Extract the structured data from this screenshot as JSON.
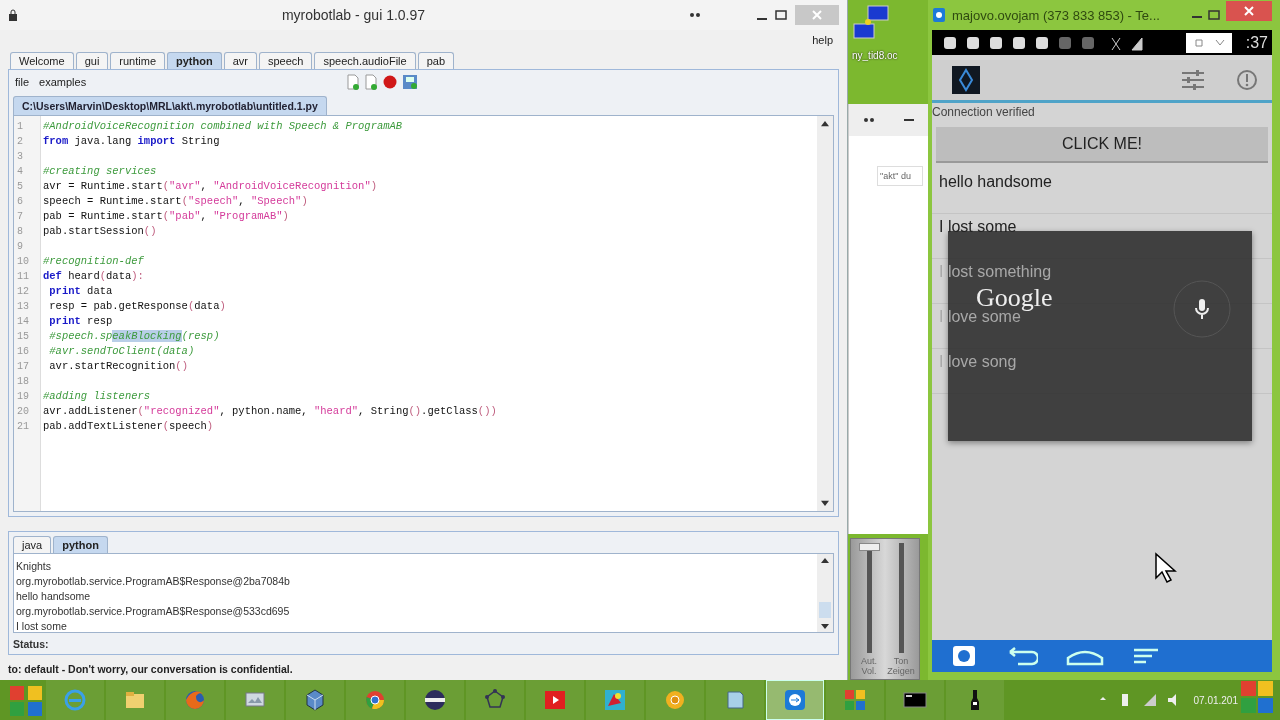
{
  "editor_window": {
    "title": "myrobotlab - gui 1.0.97",
    "menu": [
      "help"
    ],
    "tabs": [
      {
        "label": "Welcome",
        "selected": false
      },
      {
        "label": "gui",
        "selected": false
      },
      {
        "label": "runtime",
        "selected": false
      },
      {
        "label": "python",
        "selected": true
      },
      {
        "label": "avr",
        "selected": false
      },
      {
        "label": "speech",
        "selected": false
      },
      {
        "label": "speech.audioFile",
        "selected": false
      },
      {
        "label": "pab",
        "selected": false
      }
    ],
    "toolbar_menu": [
      "file",
      "examples"
    ],
    "file_tab": "C:\\Users\\Marvin\\Desktop\\MRL\\akt\\.myrobotlab\\untitled.1.py",
    "code": [
      {
        "number": "1",
        "segments": [
          {
            "text": "#AndroidVoiceRecognition combined with Speech & ProgramAB",
            "kind": "comment"
          }
        ]
      },
      {
        "number": "2",
        "segments": [
          {
            "text": "from",
            "kind": "keyword"
          },
          {
            "text": " java.lang ",
            "kind": "plain"
          },
          {
            "text": "import",
            "kind": "keyword"
          },
          {
            "text": " String",
            "kind": "plain"
          }
        ]
      },
      {
        "number": "3"
      },
      {
        "number": "4",
        "segments": [
          {
            "text": "#creating services",
            "kind": "comment"
          }
        ]
      },
      {
        "number": "5",
        "segments": [
          {
            "text": "avr = Runtime.start",
            "kind": "plain"
          },
          {
            "text": "(",
            "kind": "punct"
          },
          {
            "text": "\"avr\"",
            "kind": "string"
          },
          {
            "text": ", ",
            "kind": "plain"
          },
          {
            "text": "\"AndroidVoiceRecognition\"",
            "kind": "string"
          },
          {
            "text": ")",
            "kind": "punct"
          }
        ]
      },
      {
        "number": "6",
        "segments": [
          {
            "text": "speech = Runtime.start",
            "kind": "plain"
          },
          {
            "text": "(",
            "kind": "punct"
          },
          {
            "text": "\"speech\"",
            "kind": "string"
          },
          {
            "text": ", ",
            "kind": "plain"
          },
          {
            "text": "\"Speech\"",
            "kind": "string"
          },
          {
            "text": ")",
            "kind": "punct"
          }
        ]
      },
      {
        "number": "7",
        "segments": [
          {
            "text": "pab = Runtime.start",
            "kind": "plain"
          },
          {
            "text": "(",
            "kind": "punct"
          },
          {
            "text": "\"pab\"",
            "kind": "string"
          },
          {
            "text": ", ",
            "kind": "plain"
          },
          {
            "text": "\"ProgramAB\"",
            "kind": "string"
          },
          {
            "text": ")",
            "kind": "punct"
          }
        ]
      },
      {
        "number": "8",
        "segments": [
          {
            "text": "pab.startSession",
            "kind": "plain"
          },
          {
            "text": "()",
            "kind": "punct"
          }
        ]
      },
      {
        "number": "9"
      },
      {
        "number": "10",
        "segments": [
          {
            "text": "#recognition-def",
            "kind": "comment"
          }
        ]
      },
      {
        "number": "11",
        "segments": [
          {
            "text": "def",
            "kind": "keyword"
          },
          {
            "text": " heard",
            "kind": "plain"
          },
          {
            "text": "(",
            "kind": "punct"
          },
          {
            "text": "data",
            "kind": "plain"
          },
          {
            "text": "):",
            "kind": "punct"
          }
        ]
      },
      {
        "number": "12",
        "segments": [
          {
            "text": " print",
            "kind": "keyword"
          },
          {
            "text": " data",
            "kind": "plain"
          }
        ]
      },
      {
        "number": "13",
        "segments": [
          {
            "text": " resp = pab.getResponse",
            "kind": "plain"
          },
          {
            "text": "(",
            "kind": "punct"
          },
          {
            "text": "data",
            "kind": "plain"
          },
          {
            "text": ")",
            "kind": "punct"
          }
        ]
      },
      {
        "number": "14",
        "segments": [
          {
            "text": " print",
            "kind": "keyword"
          },
          {
            "text": " resp",
            "kind": "plain"
          }
        ]
      },
      {
        "number": "15",
        "segments": [
          {
            "text": " #speech.sp",
            "kind": "comment"
          },
          {
            "text": "eakBlocking",
            "kind": "selection"
          },
          {
            "text": "(resp)",
            "kind": "comment"
          }
        ]
      },
      {
        "number": "16",
        "segments": [
          {
            "text": " #avr.sendToClient(data)",
            "kind": "comment"
          }
        ]
      },
      {
        "number": "17",
        "segments": [
          {
            "text": " avr.startRecognition",
            "kind": "plain"
          },
          {
            "text": "()",
            "kind": "punct"
          }
        ]
      },
      {
        "number": "18"
      },
      {
        "number": "19",
        "segments": [
          {
            "text": "#adding listeners",
            "kind": "comment"
          }
        ]
      },
      {
        "number": "20",
        "segments": [
          {
            "text": "avr.addListener",
            "kind": "plain"
          },
          {
            "text": "(",
            "kind": "punct"
          },
          {
            "text": "\"recognized\"",
            "kind": "string"
          },
          {
            "text": ", python.name, ",
            "kind": "plain"
          },
          {
            "text": "\"heard\"",
            "kind": "string"
          },
          {
            "text": ", String",
            "kind": "plain"
          },
          {
            "text": "()",
            "kind": "punct"
          },
          {
            "text": ".getClass",
            "kind": "plain"
          },
          {
            "text": "())",
            "kind": "punct"
          }
        ]
      },
      {
        "number": "21",
        "segments": [
          {
            "text": "pab.addTextListener",
            "kind": "plain"
          },
          {
            "text": "(",
            "kind": "punct"
          },
          {
            "text": "speech",
            "kind": "plain"
          },
          {
            "text": ")",
            "kind": "punct"
          }
        ]
      }
    ],
    "console_tabs": [
      {
        "label": "java",
        "selected": false
      },
      {
        "label": "python",
        "selected": true
      }
    ],
    "console": [
      "Knights",
      "org.myrobotlab.service.ProgramAB$Response@2ba7084b",
      "hello handsome",
      "org.myrobotlab.service.ProgramAB$Response@533cd695",
      "I lost some"
    ],
    "status_label": "Status:",
    "status_message": "to: default - Don't worry, our conversation is confidential."
  },
  "desktop": {
    "icon_label": "ny_tid8.oc",
    "field_text": "\"akt\" du"
  },
  "volume_mixer": {
    "sliders": [
      {
        "label": "Aut. Vol.",
        "level": 1
      },
      {
        "label": "Ton Zeigen"
      }
    ]
  },
  "remote_window": {
    "title": "majovo.ovojam (373 833 853) - Te...",
    "phone": {
      "time": ":37",
      "connection": "Connection verified",
      "button": "CLICK ME!",
      "results": [
        "hello handsome",
        "I lost some",
        "I lost something",
        "I love some",
        "I love song"
      ],
      "voice_dialog": {
        "brand": "Google"
      }
    }
  },
  "taskbar": {
    "items": [
      {
        "selected": false
      },
      {
        "selected": false
      },
      {
        "selected": false
      },
      {
        "selected": false
      },
      {
        "selected": false
      },
      {
        "selected": false
      },
      {
        "selected": false
      },
      {
        "selected": false
      },
      {
        "selected": false
      },
      {
        "selected": false
      },
      {
        "selected": false
      },
      {
        "selected": false
      },
      {
        "selected": true
      },
      {
        "selected": false
      },
      {
        "selected": false
      },
      {
        "selected": false
      }
    ],
    "date": "07.01.201"
  }
}
